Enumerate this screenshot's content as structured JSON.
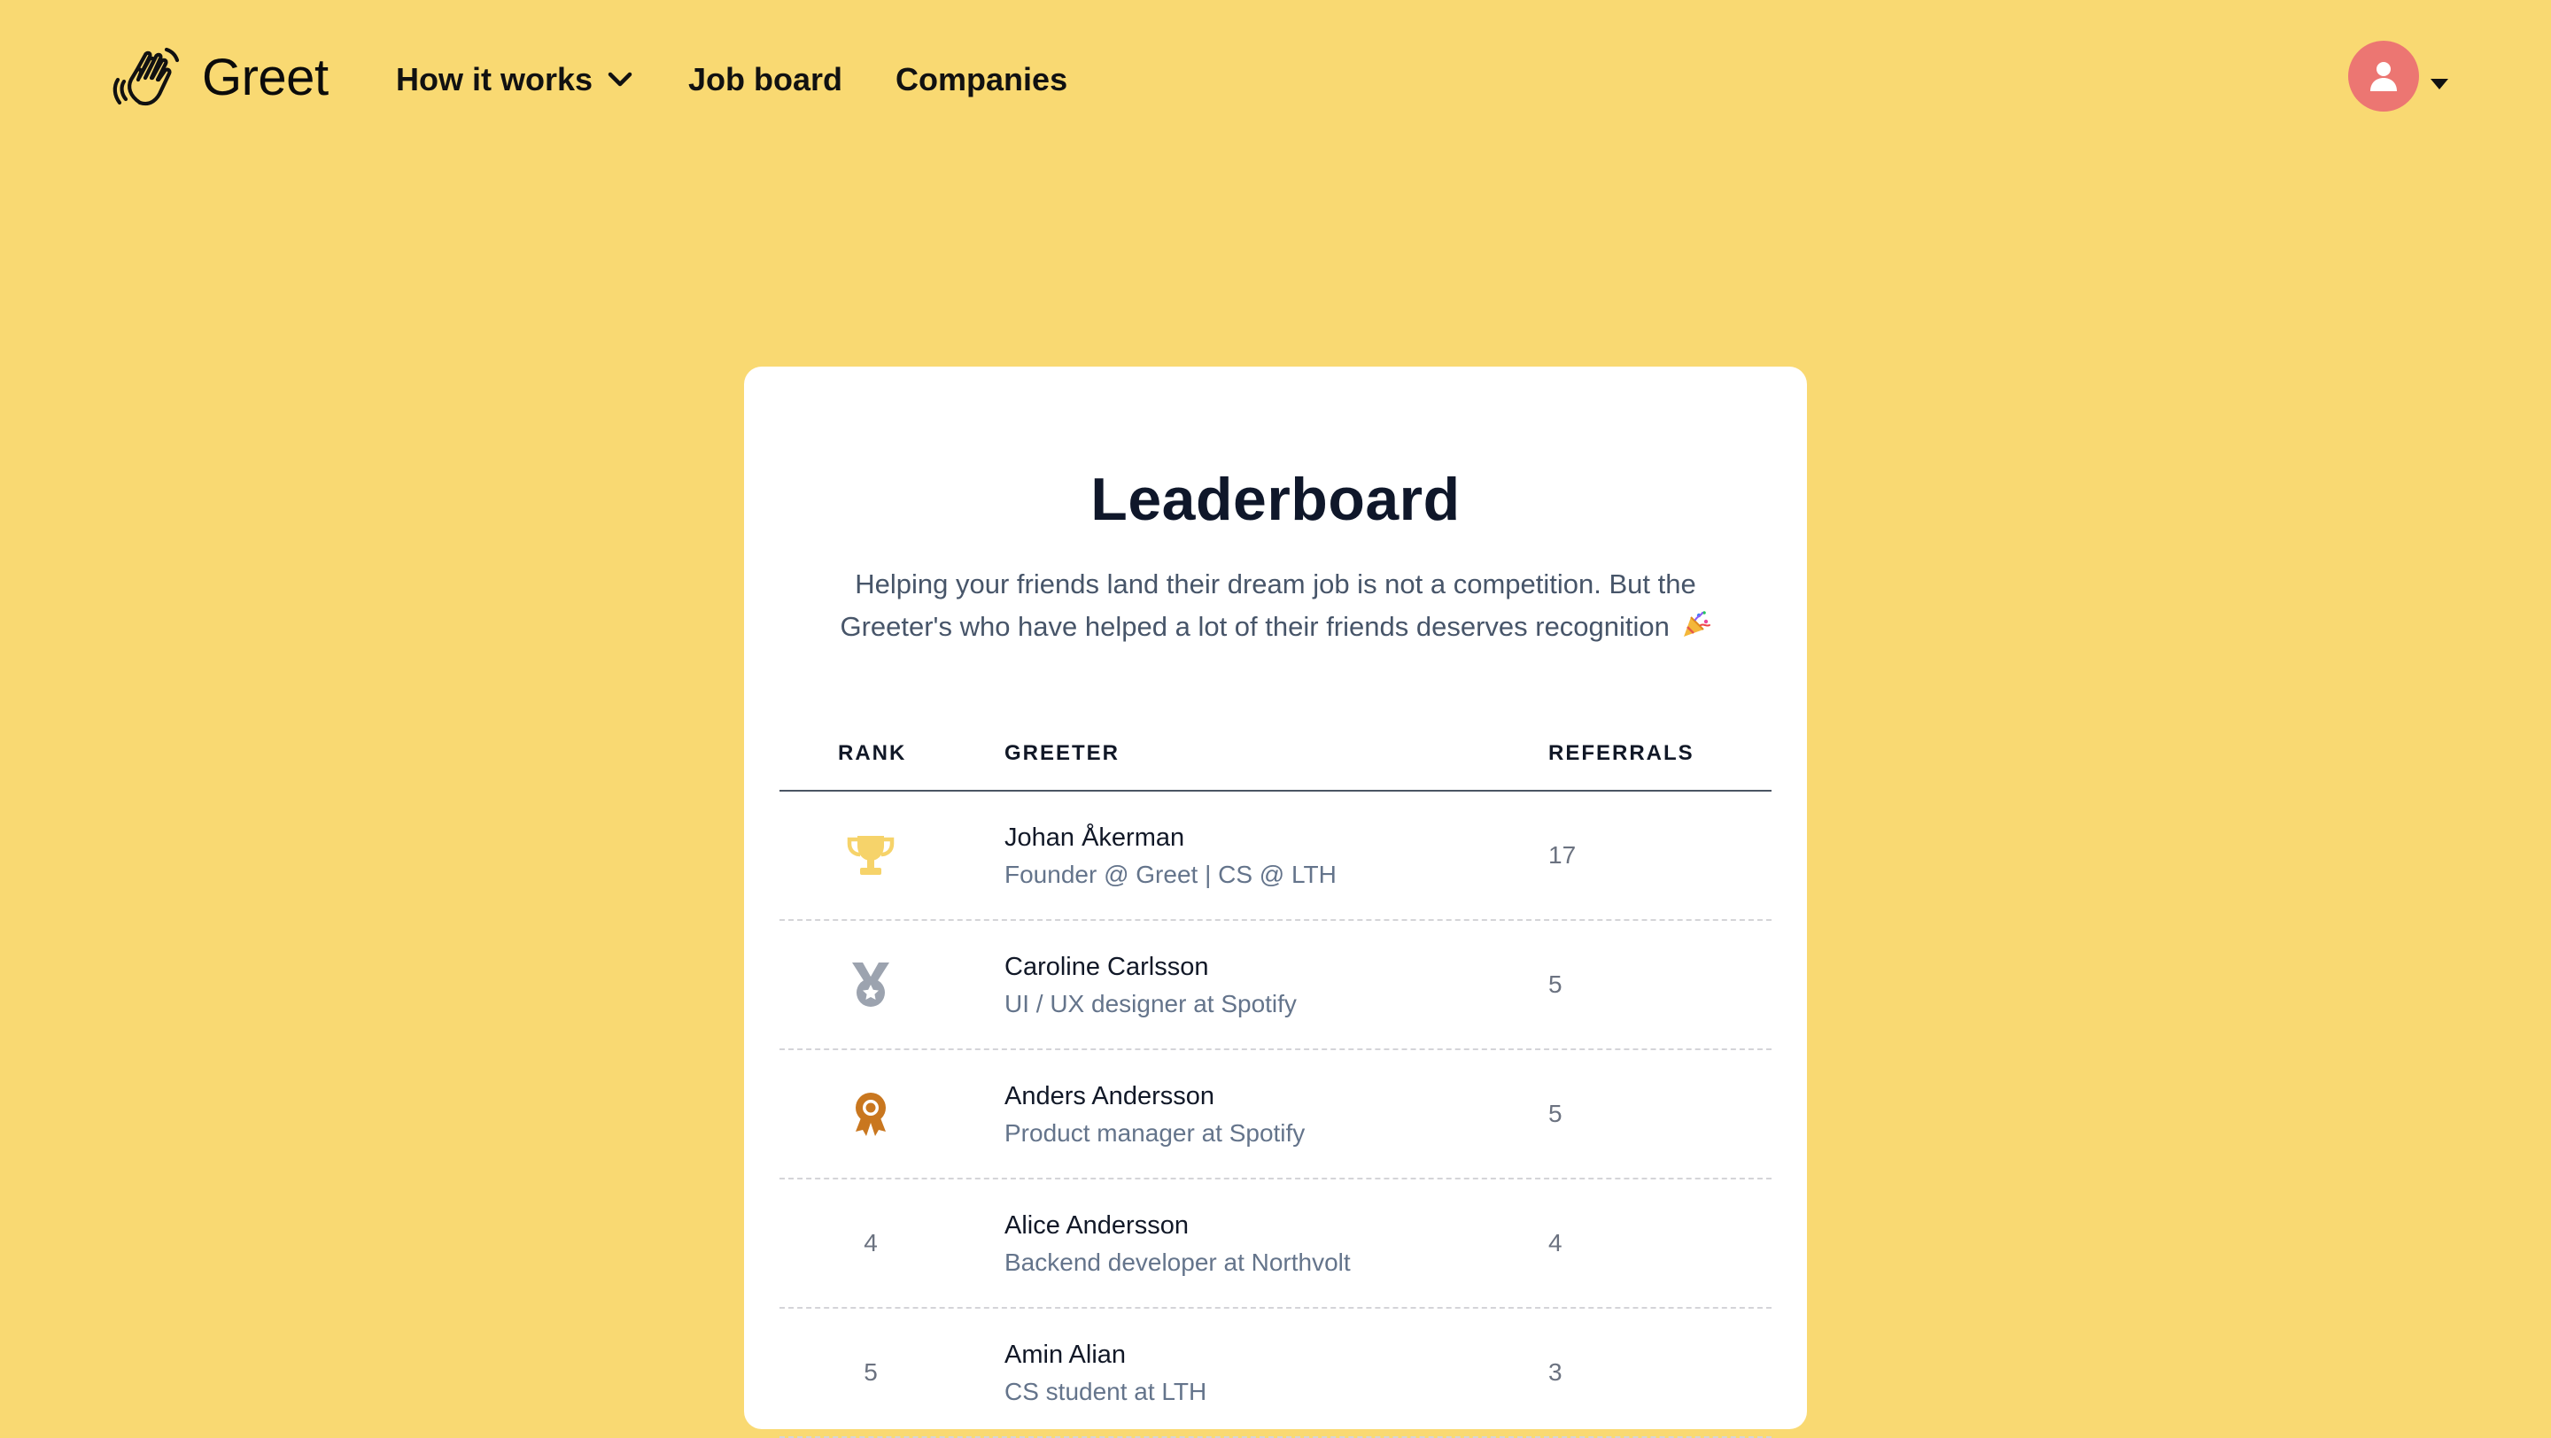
{
  "brand": {
    "name": "Greet",
    "logo_icon": "waving-hand-icon"
  },
  "nav": {
    "items": [
      {
        "label": "How it works",
        "has_dropdown": true
      },
      {
        "label": "Job board"
      },
      {
        "label": "Companies"
      }
    ]
  },
  "user_menu": {
    "avatar_icon": "user-icon",
    "avatar_color": "#ec7672"
  },
  "colors": {
    "page_background": "#f9d972",
    "gold": "#f6d36a",
    "silver": "#9ca3af",
    "bronze": "#c9771f"
  },
  "leaderboard": {
    "title": "Leaderboard",
    "subtitle": "Helping your friends land their dream job is not a competition. But the Greeter's who have helped a lot of their friends deserves recognition",
    "subtitle_emoji": "party-popper-icon",
    "columns": {
      "rank": "RANK",
      "greeter": "GREETER",
      "referrals": "REFERRALS"
    },
    "rows": [
      {
        "rank": "1",
        "rank_icon": "trophy-icon",
        "name": "Johan Åkerman",
        "title": "Founder @ Greet | CS @ LTH",
        "referrals": "17"
      },
      {
        "rank": "2",
        "rank_icon": "medal-icon",
        "name": "Caroline Carlsson",
        "title": "UI / UX designer at Spotify",
        "referrals": "5"
      },
      {
        "rank": "3",
        "rank_icon": "award-ribbon-icon",
        "name": "Anders Andersson",
        "title": "Product manager at Spotify",
        "referrals": "5"
      },
      {
        "rank": "4",
        "name": "Alice Andersson",
        "title": "Backend developer at Northvolt",
        "referrals": "4"
      },
      {
        "rank": "5",
        "name": "Amin Alian",
        "title": "CS student at LTH",
        "referrals": "3"
      }
    ]
  }
}
